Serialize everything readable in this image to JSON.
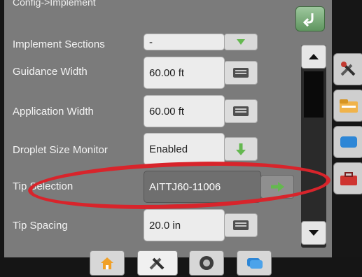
{
  "screen": {
    "title": "Config->Implement",
    "rows": [
      {
        "label": "Implement Sections",
        "value": "-"
      },
      {
        "label": "Guidance Width",
        "value": "60.00 ft"
      },
      {
        "label": "Application Width",
        "value": "60.00 ft"
      },
      {
        "label": "Droplet Size Monitor",
        "value": "Enabled"
      },
      {
        "label": "Tip Selection",
        "value": "AITTJ60-11006"
      },
      {
        "label": "Tip Spacing",
        "value": "20.0 in"
      }
    ]
  },
  "icons": {
    "back": "back-arrow-icon",
    "keyboard": "keyboard-icon",
    "down_arrow": "down-arrow-icon",
    "right_arrow": "right-arrow-icon",
    "scroll_up": "scroll-up-icon",
    "scroll_down": "scroll-down-icon"
  },
  "colors": {
    "screen_bg": "#7b7b7b",
    "green_accent": "#64b84f",
    "highlight_red": "#d8242b"
  },
  "side_tabs": [
    "config-tools-icon",
    "folder-icon",
    "blue-tab-icon",
    "toolbox-icon"
  ],
  "bottom_tabs": [
    "home-icon",
    "tools-icon",
    "gauge-icon",
    "layers-icon"
  ]
}
